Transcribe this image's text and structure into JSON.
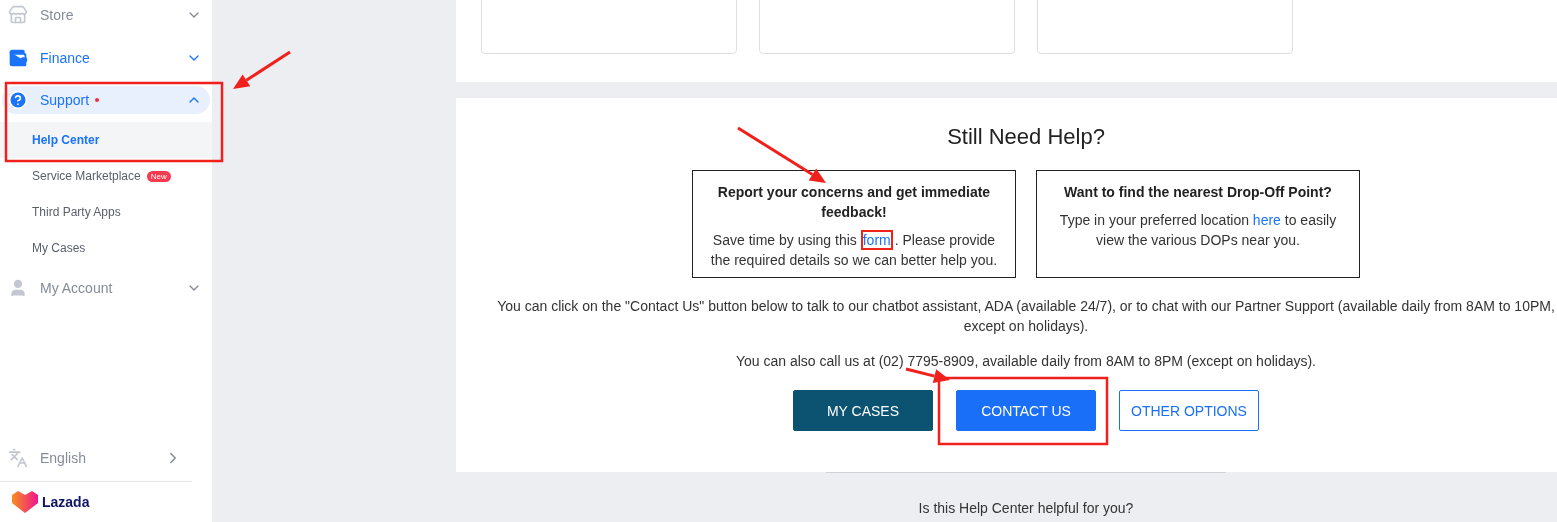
{
  "sidebar": {
    "items": [
      {
        "label": "Store",
        "active": false,
        "expanded": false
      },
      {
        "label": "Finance",
        "active": true,
        "expanded": false
      },
      {
        "label": "Support",
        "active": true,
        "expanded": true,
        "dot": true,
        "annotated": true,
        "children": [
          {
            "label": "Help Center",
            "selected": true
          },
          {
            "label": "Service Marketplace",
            "badge": "New",
            "selected": false
          },
          {
            "label": "Third Party Apps",
            "selected": false
          },
          {
            "label": "My Cases",
            "selected": false
          }
        ]
      },
      {
        "label": "My Account",
        "active": false,
        "expanded": false
      }
    ],
    "language": "English",
    "logo": "Lazada"
  },
  "top_cards": [
    {
      "kind": "blank"
    },
    {
      "kind": "blank"
    },
    {
      "kind": "blank"
    }
  ],
  "help": {
    "title": "Still Need Help?",
    "cards": [
      {
        "title": "Report your concerns and get immediate feedback!",
        "annotated": true,
        "body": [
          {
            "text": "Save time by using this "
          },
          {
            "link": "form",
            "annotated": true
          },
          {
            "text": ". Please provide the required details so we can better help you."
          }
        ]
      },
      {
        "title": "Want to find the nearest Drop-Off Point?",
        "body": [
          {
            "text": "Type in your preferred location "
          },
          {
            "link": "here"
          },
          {
            "text": " to easily view the various DOPs near you."
          }
        ]
      }
    ],
    "info": "You can click on the \"Contact Us\" button below to talk to our chatbot assistant, ADA (available 24/7), or to chat with our Partner Support (available daily from 8AM to 10PM, except on holidays).",
    "phone": "You can also call us at (02) 7795-8909, available daily from 8AM to 8PM (except on holidays).",
    "buttons": [
      {
        "label": "MY CASES",
        "kind": "dark"
      },
      {
        "label": "CONTACT US",
        "kind": "primary",
        "annotated": true
      },
      {
        "label": "OTHER OPTIONS",
        "kind": "outline"
      }
    ]
  },
  "feedback_question": "Is this Help Center helpful for you?"
}
